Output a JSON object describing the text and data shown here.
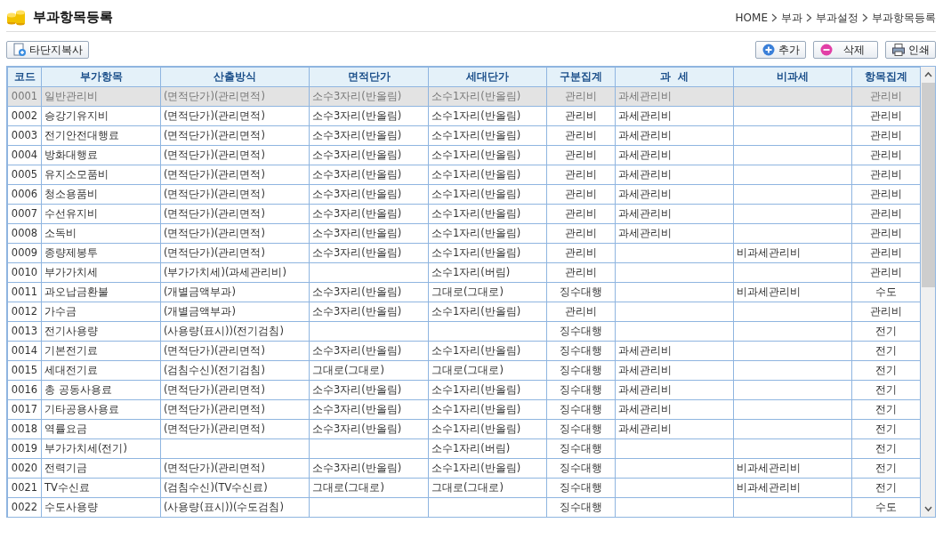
{
  "page_title": "부과항목등록",
  "breadcrumb": [
    "HOME",
    "부과",
    "부과설정",
    "부과항목등록"
  ],
  "toolbar": {
    "left_buttons": [
      {
        "label": "타단지복사",
        "kind": "copy"
      }
    ],
    "right_buttons": [
      {
        "label": "추가",
        "kind": "add"
      },
      {
        "label": "삭제",
        "kind": "delete"
      },
      {
        "label": "인쇄",
        "kind": "print"
      }
    ]
  },
  "table": {
    "columns": [
      "코드",
      "부가항목",
      "산출방식",
      "면적단가",
      "세대단가",
      "구분집계",
      "과  세",
      "비과세",
      "항목집계"
    ],
    "rows": [
      {
        "selected": true,
        "cells": [
          "0001",
          "일반관리비",
          "(면적단가)(관리면적)",
          "소수3자리(반올림)",
          "소수1자리(반올림)",
          "관리비",
          "과세관리비",
          "",
          "관리비"
        ]
      },
      {
        "selected": false,
        "cells": [
          "0002",
          "승강기유지비",
          "(면적단가)(관리면적)",
          "소수3자리(반올림)",
          "소수1자리(반올림)",
          "관리비",
          "과세관리비",
          "",
          "관리비"
        ]
      },
      {
        "selected": false,
        "cells": [
          "0003",
          "전기안전대행료",
          "(면적단가)(관리면적)",
          "소수3자리(반올림)",
          "소수1자리(반올림)",
          "관리비",
          "과세관리비",
          "",
          "관리비"
        ]
      },
      {
        "selected": false,
        "cells": [
          "0004",
          "방화대행료",
          "(면적단가)(관리면적)",
          "소수3자리(반올림)",
          "소수1자리(반올림)",
          "관리비",
          "과세관리비",
          "",
          "관리비"
        ]
      },
      {
        "selected": false,
        "cells": [
          "0005",
          "유지소모품비",
          "(면적단가)(관리면적)",
          "소수3자리(반올림)",
          "소수1자리(반올림)",
          "관리비",
          "과세관리비",
          "",
          "관리비"
        ]
      },
      {
        "selected": false,
        "cells": [
          "0006",
          "청소용품비",
          "(면적단가)(관리면적)",
          "소수3자리(반올림)",
          "소수1자리(반올림)",
          "관리비",
          "과세관리비",
          "",
          "관리비"
        ]
      },
      {
        "selected": false,
        "cells": [
          "0007",
          "수선유지비",
          "(면적단가)(관리면적)",
          "소수3자리(반올림)",
          "소수1자리(반올림)",
          "관리비",
          "과세관리비",
          "",
          "관리비"
        ]
      },
      {
        "selected": false,
        "cells": [
          "0008",
          "소독비",
          "(면적단가)(관리면적)",
          "소수3자리(반올림)",
          "소수1자리(반올림)",
          "관리비",
          "과세관리비",
          "",
          "관리비"
        ]
      },
      {
        "selected": false,
        "cells": [
          "0009",
          "종량제봉투",
          "(면적단가)(관리면적)",
          "소수3자리(반올림)",
          "소수1자리(반올림)",
          "관리비",
          "",
          "비과세관리비",
          "관리비"
        ]
      },
      {
        "selected": false,
        "cells": [
          "0010",
          "부가가치세",
          "(부가가치세)(과세관리비)",
          "",
          "소수1자리(버림)",
          "관리비",
          "",
          "",
          "관리비"
        ]
      },
      {
        "selected": false,
        "cells": [
          "0011",
          "과오납금환불",
          "(개별금액부과)",
          "소수3자리(반올림)",
          "그대로(그대로)",
          "징수대행",
          "",
          "비과세관리비",
          "수도"
        ]
      },
      {
        "selected": false,
        "cells": [
          "0012",
          "가수금",
          "(개별금액부과)",
          "소수3자리(반올림)",
          "소수1자리(반올림)",
          "관리비",
          "",
          "",
          "관리비"
        ]
      },
      {
        "selected": false,
        "cells": [
          "0013",
          "전기사용량",
          "(사용량(표시))(전기검침)",
          "",
          "",
          "징수대행",
          "",
          "",
          "전기"
        ]
      },
      {
        "selected": false,
        "cells": [
          "0014",
          "기본전기료",
          "(면적단가)(관리면적)",
          "소수3자리(반올림)",
          "소수1자리(반올림)",
          "징수대행",
          "과세관리비",
          "",
          "전기"
        ]
      },
      {
        "selected": false,
        "cells": [
          "0015",
          "세대전기료",
          "(검침수신)(전기검침)",
          "그대로(그대로)",
          "그대로(그대로)",
          "징수대행",
          "과세관리비",
          "",
          "전기"
        ]
      },
      {
        "selected": false,
        "cells": [
          "0016",
          "총 공동사용료",
          "(면적단가)(관리면적)",
          "소수3자리(반올림)",
          "소수1자리(반올림)",
          "징수대행",
          "과세관리비",
          "",
          "전기"
        ]
      },
      {
        "selected": false,
        "cells": [
          "0017",
          "기타공용사용료",
          "(면적단가)(관리면적)",
          "소수3자리(반올림)",
          "소수1자리(반올림)",
          "징수대행",
          "과세관리비",
          "",
          "전기"
        ]
      },
      {
        "selected": false,
        "cells": [
          "0018",
          "역률요금",
          "(면적단가)(관리면적)",
          "소수3자리(반올림)",
          "소수1자리(반올림)",
          "징수대행",
          "과세관리비",
          "",
          "전기"
        ]
      },
      {
        "selected": false,
        "cells": [
          "0019",
          "부가가치세(전기)",
          "",
          "",
          "소수1자리(버림)",
          "징수대행",
          "",
          "",
          "전기"
        ]
      },
      {
        "selected": false,
        "cells": [
          "0020",
          "전력기금",
          "(면적단가)(관리면적)",
          "소수3자리(반올림)",
          "소수1자리(반올림)",
          "징수대행",
          "",
          "비과세관리비",
          "전기"
        ]
      },
      {
        "selected": false,
        "cells": [
          "0021",
          "TV수신료",
          "(검침수신)(TV수신료)",
          "그대로(그대로)",
          "그대로(그대로)",
          "징수대행",
          "",
          "비과세관리비",
          "전기"
        ]
      },
      {
        "selected": false,
        "cells": [
          "0022",
          "수도사용량",
          "(사용량(표시))(수도검침)",
          "",
          "",
          "징수대행",
          "",
          "",
          "수도"
        ]
      }
    ]
  }
}
